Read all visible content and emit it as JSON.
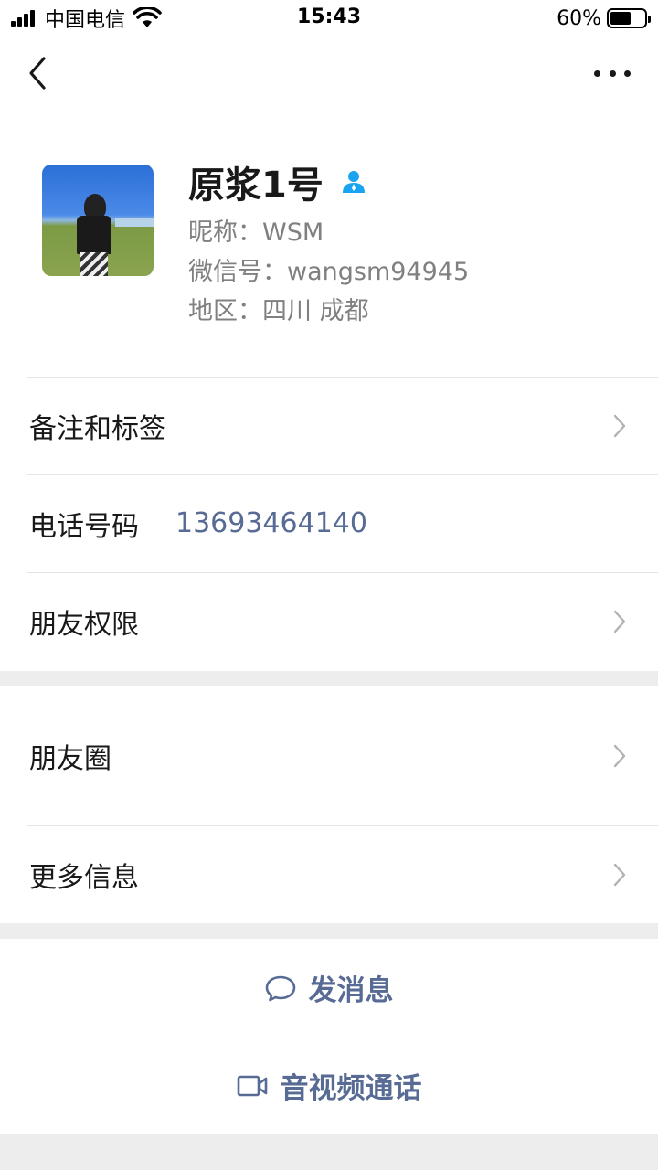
{
  "status_bar": {
    "carrier": "中国电信",
    "time": "15:43",
    "battery_percent": "60%",
    "battery_level": 0.6
  },
  "profile": {
    "name": "原浆1号",
    "nickname_line": "昵称：WSM",
    "wechat_id_line": "微信号：wangsm94945",
    "region_line": "地区：四川 成都"
  },
  "cells": {
    "remark_tags": "备注和标签",
    "phone_label": "电话号码",
    "phone_value": "13693464140",
    "friend_permissions": "朋友权限",
    "moments": "朋友圈",
    "more_info": "更多信息"
  },
  "actions": {
    "send_message": "发消息",
    "video_call": "音视频通话"
  },
  "colors": {
    "link_blue": "#576b95",
    "background": "#ededed",
    "verified_icon": "#1aa3f0"
  }
}
